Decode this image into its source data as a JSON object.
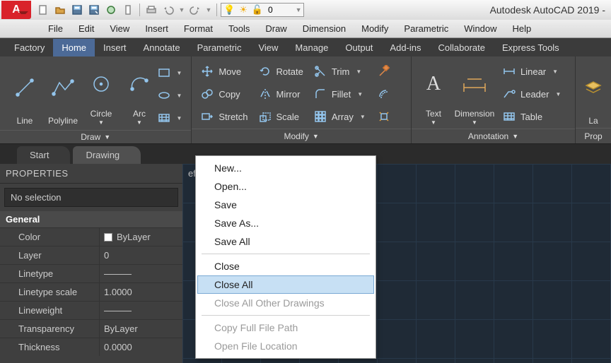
{
  "title": "Autodesk AutoCAD 2019 -",
  "app_logo_text": "A",
  "search_value": "0",
  "menubar": [
    "File",
    "Edit",
    "View",
    "Insert",
    "Format",
    "Tools",
    "Draw",
    "Dimension",
    "Modify",
    "Parametric",
    "Window",
    "Help"
  ],
  "ribbon_tabs": [
    "Factory",
    "Home",
    "Insert",
    "Annotate",
    "Parametric",
    "View",
    "Manage",
    "Output",
    "Add-ins",
    "Collaborate",
    "Express Tools"
  ],
  "ribbon_active": "Home",
  "draw_panel": {
    "title": "Draw",
    "items": [
      "Line",
      "Polyline",
      "Circle",
      "Arc"
    ]
  },
  "modify_panel": {
    "title": "Modify",
    "col1": [
      "Move",
      "Copy",
      "Stretch"
    ],
    "col2": [
      "Rotate",
      "Mirror",
      "Scale"
    ],
    "col3": [
      "Trim",
      "Fillet",
      "Array"
    ]
  },
  "annotation_panel": {
    "title": "Annotation",
    "big": [
      "Text",
      "Dimension"
    ],
    "rows": [
      "Linear",
      "Leader",
      "Table"
    ]
  },
  "last_panel_label": "La",
  "last_panel_title": "Prop",
  "drawing_tabs": [
    "Start",
    "Drawing"
  ],
  "properties": {
    "header": "PROPERTIES",
    "selection": "No selection",
    "category": "General",
    "rows": [
      {
        "k": "Color",
        "v": "ByLayer",
        "swatch": true
      },
      {
        "k": "Layer",
        "v": "0"
      },
      {
        "k": "Linetype",
        "v": "———"
      },
      {
        "k": "Linetype scale",
        "v": "1.0000"
      },
      {
        "k": "Lineweight",
        "v": "———"
      },
      {
        "k": "Transparency",
        "v": "ByLayer"
      },
      {
        "k": "Thickness",
        "v": "0.0000"
      }
    ]
  },
  "view_label": "eframe]",
  "context_menu": {
    "items": [
      {
        "label": "New...",
        "type": "item"
      },
      {
        "label": "Open...",
        "type": "item"
      },
      {
        "label": "Save",
        "type": "item"
      },
      {
        "label": "Save As...",
        "type": "item"
      },
      {
        "label": "Save All",
        "type": "item"
      },
      {
        "type": "sep"
      },
      {
        "label": "Close",
        "type": "item"
      },
      {
        "label": "Close All",
        "type": "item",
        "highlight": true
      },
      {
        "label": "Close All Other Drawings",
        "type": "item",
        "disabled": true
      },
      {
        "type": "sep"
      },
      {
        "label": "Copy Full File Path",
        "type": "item",
        "disabled": true
      },
      {
        "label": "Open File Location",
        "type": "item",
        "disabled": true
      }
    ]
  }
}
